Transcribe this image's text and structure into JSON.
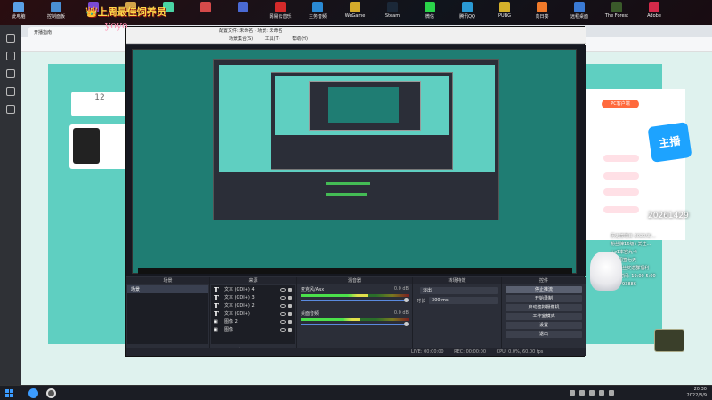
{
  "desktop": {
    "icons": [
      {
        "label": "此电脑",
        "color": "#5aa0e6"
      },
      {
        "label": "控制面板",
        "color": "#4a8fd4"
      },
      {
        "label": "",
        "color": "#7a4ad4"
      },
      {
        "label": "",
        "color": "#d4a44a"
      },
      {
        "label": "",
        "color": "#4ad4a4"
      },
      {
        "label": "",
        "color": "#d44a4a"
      },
      {
        "label": "",
        "color": "#4a6ad4"
      },
      {
        "label": "网易云音乐",
        "color": "#d42a2a"
      },
      {
        "label": "主务音频",
        "color": "#2a8ad4"
      },
      {
        "label": "WeGame",
        "color": "#d4aa2a"
      },
      {
        "label": "Steam",
        "color": "#1b2838"
      },
      {
        "label": "微信",
        "color": "#2ad44a"
      },
      {
        "label": "腾讯QQ",
        "color": "#2a9ad4"
      },
      {
        "label": "PUBG",
        "color": "#d4b02a"
      },
      {
        "label": "向日葵",
        "color": "#f07a2a"
      },
      {
        "label": "远程桌面",
        "color": "#3a7ad4"
      },
      {
        "label": "The Forest",
        "color": "#3a5a2a"
      },
      {
        "label": "Adobe",
        "color": "#d42a4a"
      }
    ]
  },
  "overlay": {
    "title": "👑上周最佳饲养员",
    "id_text": "yoyo",
    "notes": [
      "历史撞墙日 2020/3/...",
      "粉丝牌16级+关注...",
      "+z1本宫九卡",
      "+1 周签七天",
      "8级粉丝奖进群福利",
      "直播时间: 19:00-5:00",
      "DY8793886"
    ],
    "big_number": "20261429"
  },
  "browser": {
    "tab_title": "开播指南",
    "card_count": "12",
    "card_sub": "",
    "pc_button": "PC客户端",
    "logo_text": "主播",
    "gift_rows": [
      "",
      "",
      "",
      "",
      ""
    ]
  },
  "obs": {
    "title": "配置文件: 未命名 - 场景: 未命名",
    "menu": [
      "场景集合(S)",
      "工具(T)",
      "帮助(H)"
    ],
    "no_scene": "未选择源",
    "docks": {
      "scenes": {
        "header": "场景",
        "items": [
          "场景"
        ]
      },
      "sources": {
        "header": "来源",
        "items": [
          {
            "icon": "T",
            "name": "文本 (GDI+) 4"
          },
          {
            "icon": "T",
            "name": "文本 (GDI+) 3"
          },
          {
            "icon": "T",
            "name": "文本 (GDI+) 2"
          },
          {
            "icon": "T",
            "name": "文本 (GDI+)"
          },
          {
            "icon": "▣",
            "name": "图像 2"
          },
          {
            "icon": "▣",
            "name": "图像"
          }
        ]
      },
      "mixer": {
        "header": "混音器",
        "channels": [
          {
            "name": "麦克风/Aux",
            "db": "0.0 dB",
            "level": 0.62
          },
          {
            "name": "桌面音频",
            "db": "0.0 dB",
            "level": 0.55
          }
        ]
      },
      "transitions": {
        "header": "转场特效",
        "type": "淡出",
        "duration_label": "时长",
        "duration": "300 ms"
      },
      "controls": {
        "header": "控件",
        "buttons": [
          "停止推流",
          "开始录制",
          "启动虚拟摄像机",
          "工作室模式",
          "设置",
          "退出"
        ]
      }
    },
    "status": {
      "live": "LIVE: 00:00:00",
      "rec": "REC: 00:00:00",
      "cpu": "CPU: 0.0%, 60.00 fps"
    }
  },
  "taskbar": {
    "time": "20:30",
    "date": "2022/3/9"
  }
}
